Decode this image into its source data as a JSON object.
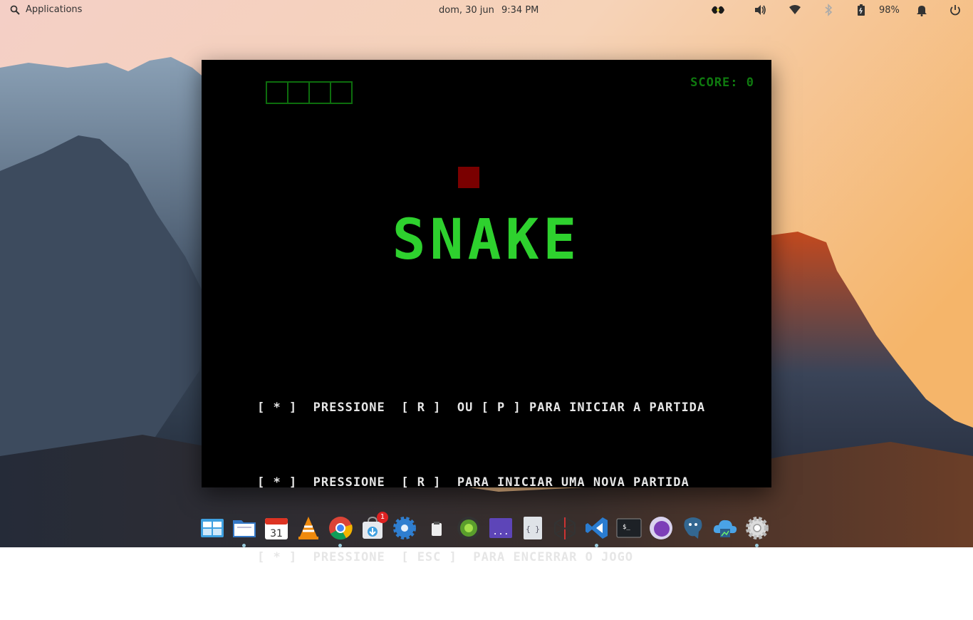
{
  "panel": {
    "applications_label": "Applications",
    "date": "dom, 30 jun",
    "time": "9:34 PM",
    "battery_percent": "98%"
  },
  "game": {
    "score_text": "SCORE: 0",
    "lives_count": 4,
    "title": "SNAKE",
    "instructions": [
      "[ * ]  PRESSIONE  [ R ]  OU [ P ] PARA INICIAR A PARTIDA",
      "[ * ]  PRESSIONE  [ R ]  PARA INICIAR UMA NOVA PARTIDA",
      "[ * ]  PRESSIONE  [ ESC ]  PARA ENCERRAR O JOGO"
    ],
    "colors": {
      "title": "#2ed12e",
      "score": "#0f7a0f",
      "food": "#7a0000",
      "text": "#e6e6e6"
    }
  },
  "dock": {
    "apps": [
      {
        "icon": "multitasking-view-icon"
      },
      {
        "icon": "files-icon"
      },
      {
        "icon": "calendar-icon",
        "label": "31"
      },
      {
        "icon": "vlc-icon"
      },
      {
        "icon": "chrome-icon"
      },
      {
        "icon": "appcenter-icon",
        "badge": "1"
      },
      {
        "icon": "settings-gear-icon"
      },
      {
        "icon": "clipboard-icon"
      },
      {
        "icon": "green-orb-icon"
      },
      {
        "icon": "terminal-purple-icon",
        "label": "..."
      },
      {
        "icon": "code-braces-icon",
        "label": "{ }"
      },
      {
        "icon": "network-web-icon"
      },
      {
        "icon": "vscode-icon"
      },
      {
        "icon": "terminal-icon",
        "label": "$_"
      },
      {
        "icon": "purple-orb-icon"
      },
      {
        "icon": "postgresql-icon"
      },
      {
        "icon": "cloud-icon"
      },
      {
        "icon": "system-settings-icon"
      }
    ]
  }
}
